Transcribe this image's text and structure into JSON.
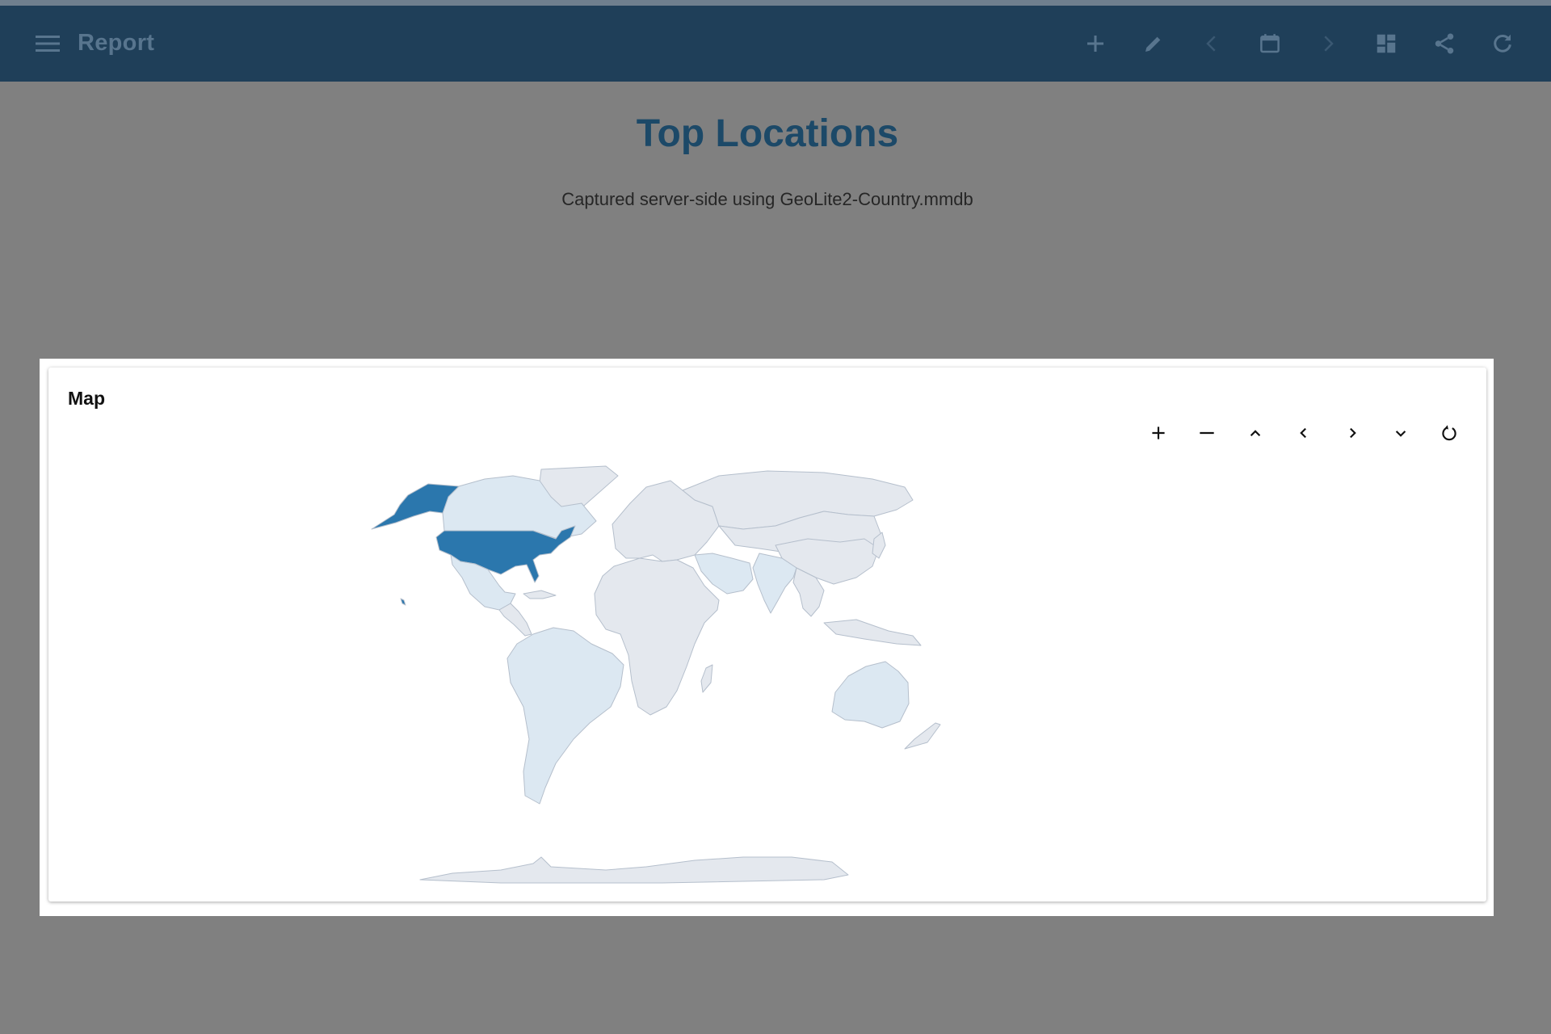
{
  "appbar": {
    "title": "Report",
    "actions": [
      {
        "icon": "plus-icon"
      },
      {
        "icon": "pencil-icon"
      },
      {
        "icon": "chevron-left-icon"
      },
      {
        "icon": "calendar-icon"
      },
      {
        "icon": "chevron-right-icon"
      },
      {
        "icon": "dashboard-icon"
      },
      {
        "icon": "share-icon"
      },
      {
        "icon": "refresh-icon"
      }
    ]
  },
  "page": {
    "title": "Top Locations",
    "subtitle": "Captured server-side using GeoLite2-Country.mmdb"
  },
  "panel": {
    "title": "Map",
    "controls": [
      {
        "icon": "zoom-in-icon"
      },
      {
        "icon": "zoom-out-icon"
      },
      {
        "icon": "pan-up-icon"
      },
      {
        "icon": "pan-left-icon"
      },
      {
        "icon": "pan-right-icon"
      },
      {
        "icon": "pan-down-icon"
      },
      {
        "icon": "reset-view-icon"
      }
    ]
  },
  "colors": {
    "appbar": "#1f3f59",
    "page_title": "#1c4968",
    "map_high": "#2b77ad",
    "map_medium": "#dce8f2",
    "map_base": "#e4e8ee",
    "map_border": "#b5bfcc"
  }
}
